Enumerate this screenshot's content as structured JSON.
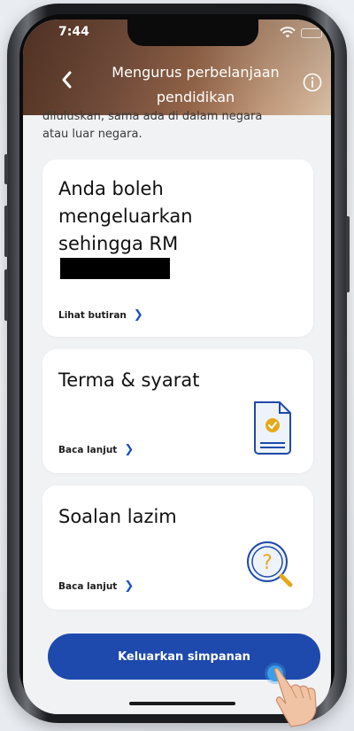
{
  "status_bar": {
    "time": "7:44"
  },
  "header": {
    "title_line1": "Mengurus perbelanjaan",
    "title_line2": "pendidikan"
  },
  "intro_text": {
    "line1": "diluluskan, sama ada di dalam negara",
    "line2": "atau luar negara."
  },
  "cards": [
    {
      "title_lines": [
        "Anda boleh",
        "mengeluarkan",
        "sehingga RM"
      ],
      "link": "Lihat butiran"
    },
    {
      "title_lines": [
        "Terma & syarat"
      ],
      "link": "Baca lanjut",
      "icon": "document-check-icon"
    },
    {
      "title_lines": [
        "Soalan lazim"
      ],
      "link": "Baca lanjut",
      "icon": "magnifier-question-icon"
    }
  ],
  "cta": {
    "label": "Keluarkan simpanan"
  },
  "colors": {
    "primary": "#1e49ad",
    "link_chevron": "#1f4fbf",
    "icon_accent": "#e3a91d",
    "icon_stroke": "#1e4aa8"
  }
}
